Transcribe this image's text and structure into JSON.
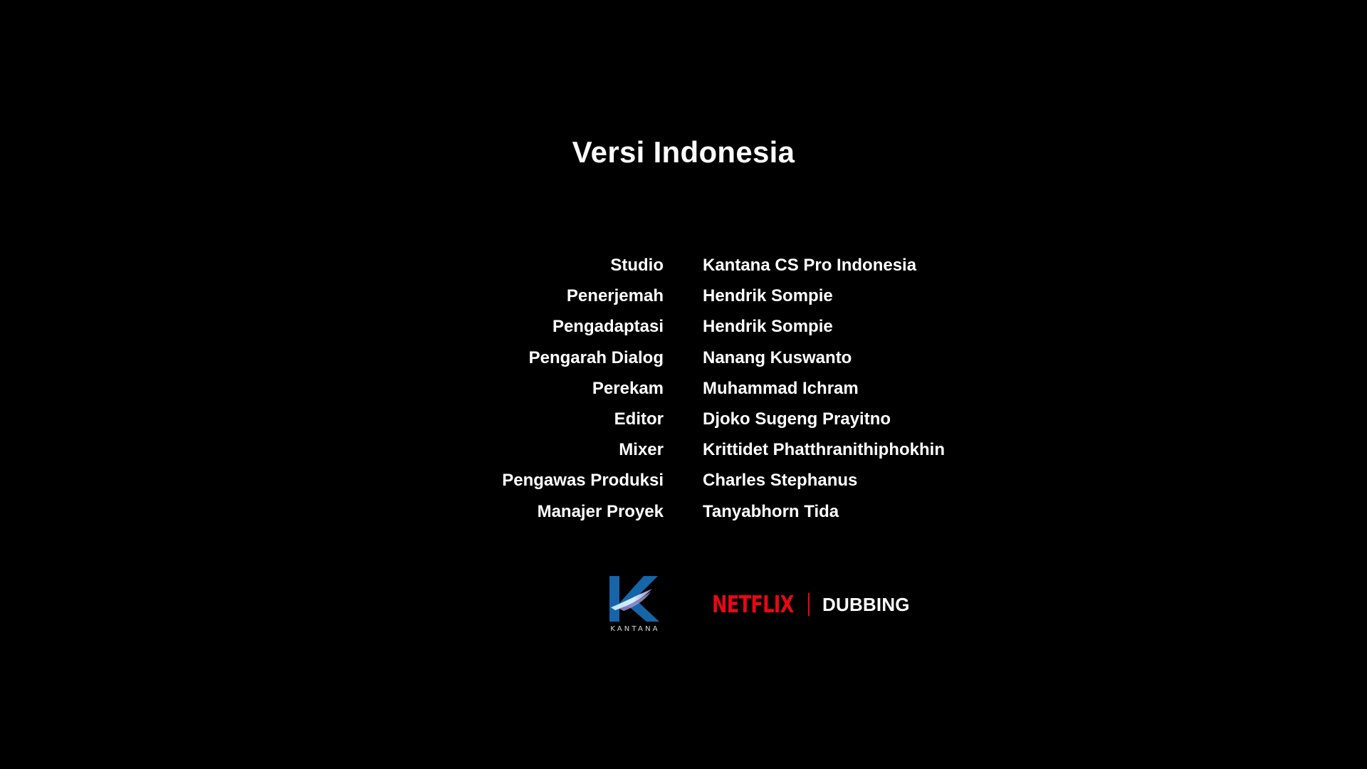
{
  "screen": {
    "title": "Versi Indonesia",
    "credits": [
      {
        "role": "Studio",
        "name": "Kantana CS Pro Indonesia"
      },
      {
        "role": "Penerjemah",
        "name": "Hendrik Sompie"
      },
      {
        "role": "Pengadaptasi",
        "name": "Hendrik Sompie"
      },
      {
        "role": "Pengarah Dialog",
        "name": "Nanang Kuswanto"
      },
      {
        "role": "Perekam",
        "name": "Muhammad Ichram"
      },
      {
        "role": "Editor",
        "name": "Djoko Sugeng Prayitno"
      },
      {
        "role": "Mixer",
        "name": "Krittidet Phatthranithiphokhin"
      },
      {
        "role": "Pengawas Produksi",
        "name": "Charles Stephanus"
      },
      {
        "role": "Manajer Proyek",
        "name": "Tanyabhorn Tida"
      }
    ]
  },
  "logos": {
    "kantana": {
      "wordmark": "KANTANA",
      "icon": "kantana-k-logo",
      "colors": {
        "k": "#1565a8",
        "swoosh_light": "#bfe3f2",
        "swoosh_mid": "#8f86c8"
      }
    },
    "netflix": {
      "wordmark": "NETFLIX",
      "color": "#e50914"
    },
    "dubbing_label": "DUBBING"
  },
  "colors": {
    "background": "#000000",
    "text": "#ffffff"
  }
}
